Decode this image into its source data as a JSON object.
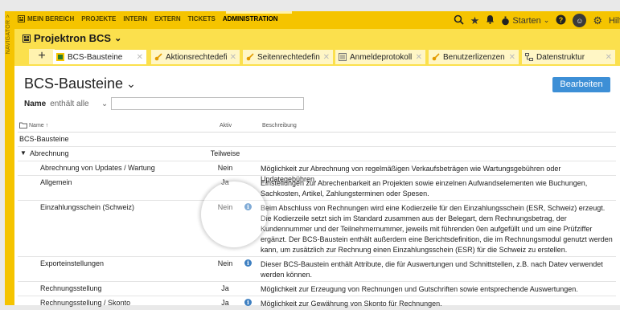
{
  "window": {
    "sidebar_label": "NAVIGATOR >"
  },
  "topbar": {
    "menu": [
      {
        "label": "MEIN BEREICH"
      },
      {
        "label": "PROJEKTE"
      },
      {
        "label": "INTERN"
      },
      {
        "label": "EXTERN"
      },
      {
        "label": "TICKETS"
      },
      {
        "label": "ADMINISTRATION"
      }
    ],
    "start_label": "Starten",
    "help_label": "Hilfe",
    "active_color": "#f5c400"
  },
  "project": {
    "title": "Projektron BCS"
  },
  "tabs": [
    {
      "label": "BCS-Bausteine",
      "icon": "bcs-module-icon"
    },
    {
      "label": "Aktionsrechtedefinitic",
      "icon": "key-icon"
    },
    {
      "label": "Seitenrechtedefinition",
      "icon": "key-icon"
    },
    {
      "label": "Anmeldeprotokoll",
      "icon": "list-icon"
    },
    {
      "label": "Benutzerlizenzen",
      "icon": "key-icon"
    },
    {
      "label": "Datenstruktur",
      "icon": "structure-icon"
    }
  ],
  "page": {
    "title": "BCS-Bausteine",
    "edit_label": "Bearbeiten",
    "filter_field": "Name",
    "filter_op": "enthält alle"
  },
  "table": {
    "headers": {
      "name": "Name ↑",
      "aktiv": "Aktiv",
      "desc": "Beschreibung"
    },
    "rows": [
      {
        "name": "BCS-Bausteine",
        "aktiv": "",
        "desc": ""
      },
      {
        "name": "Abrechnung",
        "aktiv": "Teilweise",
        "desc": ""
      },
      {
        "name": "Abrechnung von Updates / Wartung",
        "aktiv": "Nein",
        "desc": "Möglichkeit zur Abrechnung von regelmäßigen Verkaufsbeträgen wie Wartungsgebühren oder Updategebühren."
      },
      {
        "name": "Allgemein",
        "aktiv": "Ja",
        "desc": "Einstellungen zur Abrechenbarkeit an Projekten sowie einzelnen Aufwandselementen wie Buchungen, Sachkosten, Artikel, Zahlungsterminen oder Spesen."
      },
      {
        "name": "Einzahlungsschein (Schweiz)",
        "aktiv": "Nein",
        "desc": "Beim Abschluss von Rechnungen wird eine Kodierzeile für den Einzahlungsschein (ESR, Schweiz) erzeugt. Die Kodierzeile setzt sich im Standard zusammen aus der Belegart, dem Rechnungsbetrag, der Kundennummer und der Teilnehmernummer, jeweils mit führenden 0en aufgefüllt und um eine Prüfziffer ergänzt. Der BCS-Baustein enthält außerdem eine Berichtsdefinition, die im Rechnungsmodul genutzt werden kann, um zusätzlich zur Rechnung einen Einzahlungsschein (ESR) für die Schweiz zu erstellen."
      },
      {
        "name": "Exporteinstellungen",
        "aktiv": "Nein",
        "desc": "Dieser BCS-Baustein enthält Attribute, die für Auswertungen und Schnittstellen, z.B. nach Datev verwendet werden können."
      },
      {
        "name": "Rechnungsstellung",
        "aktiv": "Ja",
        "desc": "Möglichkeit zur Erzeugung von Rechnungen und Gutschriften sowie entsprechende Auswertungen."
      },
      {
        "name": "Rechnungsstellung / Skonto",
        "aktiv": "Ja",
        "desc": "Möglichkeit zur Gewährung von Skonto für Rechnungen."
      }
    ]
  }
}
